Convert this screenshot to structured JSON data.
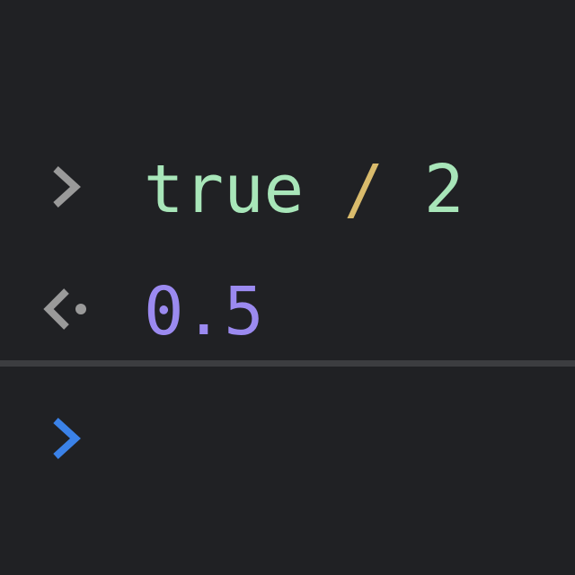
{
  "console": {
    "input": {
      "operand_left": "true",
      "operator": "/",
      "operand_right": "2"
    },
    "result": {
      "value": "0.5"
    }
  },
  "colors": {
    "background": "#202124",
    "keyword": "#a8e6b9",
    "operator": "#d9bb6c",
    "number_input": "#a8e6b9",
    "result_number": "#9b8af0",
    "gutter_gray": "#9a9a9a",
    "prompt_blue": "#3b82e8",
    "divider": "#3c3d40"
  },
  "icons": {
    "input_marker": "chevron-right-icon",
    "result_marker": "return-arrow-icon",
    "prompt_marker": "chevron-right-icon"
  }
}
